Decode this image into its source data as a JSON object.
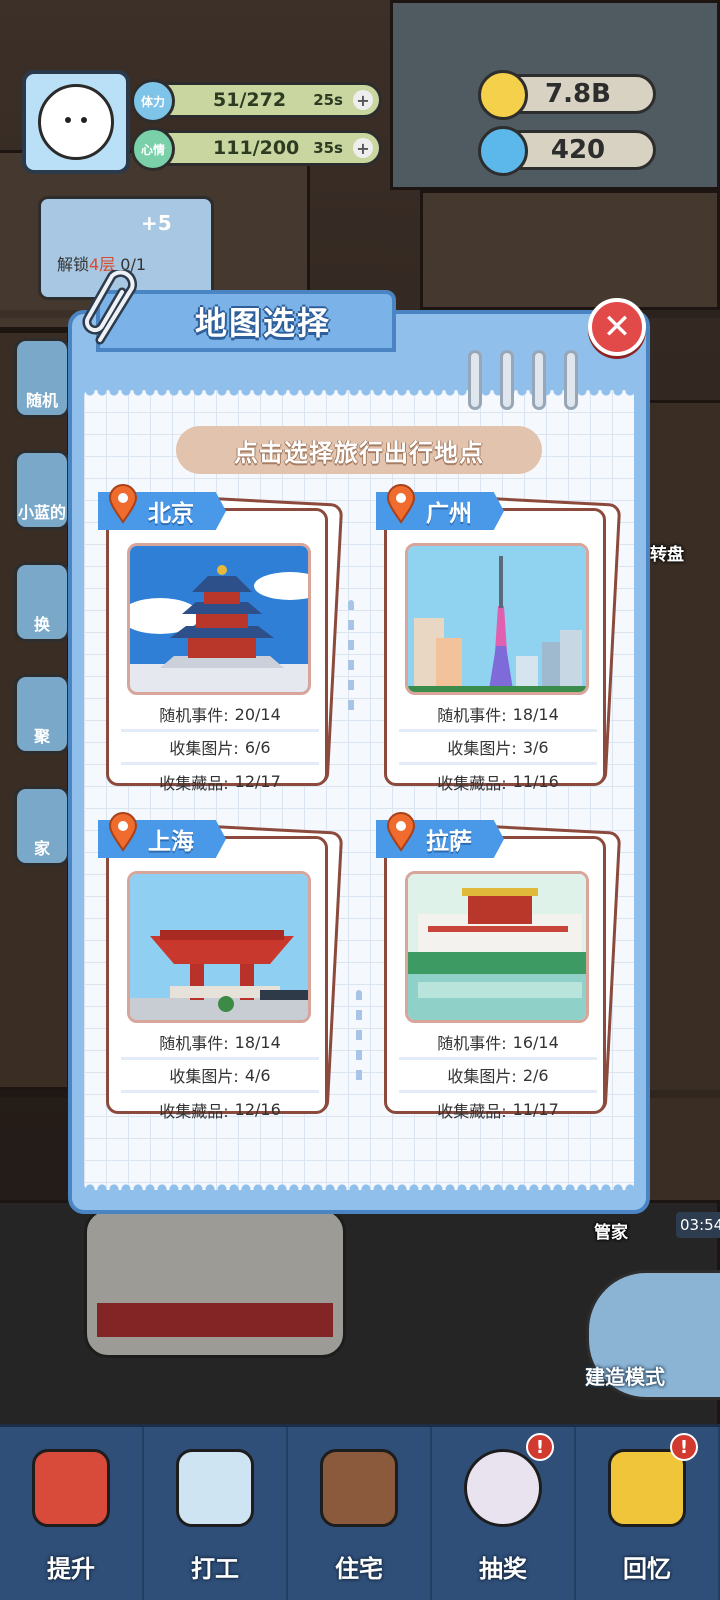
{
  "hud": {
    "stamina_label": "体力",
    "stamina_value": "51/272",
    "stamina_timer": "25s",
    "mood_label": "心情",
    "mood_value": "111/200",
    "mood_timer": "35s",
    "coins": "7.8B",
    "gems": "420",
    "unlock_prefix": "解锁",
    "unlock_highlight": "4层",
    "unlock_progress": "0/1",
    "unlock_badge": "+5"
  },
  "side_buttons": [
    "随机",
    "小蓝的",
    "换",
    "聚",
    "家"
  ],
  "right_labels": {
    "wheel": "转盘",
    "butler": "管家",
    "butler_timer": "03:54",
    "build_mode": "建造模式"
  },
  "modal": {
    "title": "地图选择",
    "subtitle": "点击选择旅行出行地点",
    "close_symbol": "✕",
    "cities": [
      {
        "name": "北京",
        "events_label": "随机事件:",
        "events": "20/14",
        "photos_label": "收集图片:",
        "photos": "6/6",
        "items_label": "收集藏品:",
        "items": "12/17"
      },
      {
        "name": "广州",
        "events_label": "随机事件:",
        "events": "18/14",
        "photos_label": "收集图片:",
        "photos": "3/6",
        "items_label": "收集藏品:",
        "items": "11/16"
      },
      {
        "name": "上海",
        "events_label": "随机事件:",
        "events": "18/14",
        "photos_label": "收集图片:",
        "photos": "4/6",
        "items_label": "收集藏品:",
        "items": "12/16"
      },
      {
        "name": "拉萨",
        "events_label": "随机事件:",
        "events": "16/14",
        "photos_label": "收集图片:",
        "photos": "2/6",
        "items_label": "收集藏品:",
        "items": "11/17"
      }
    ]
  },
  "bottom_nav": [
    {
      "label": "提升",
      "alert": ""
    },
    {
      "label": "打工",
      "alert": ""
    },
    {
      "label": "住宅",
      "alert": ""
    },
    {
      "label": "抽奖",
      "alert": "!"
    },
    {
      "label": "回忆",
      "alert": "!"
    }
  ],
  "colors": {
    "modal_frame": "#8fbfea",
    "modal_border": "#4a84c3",
    "card_border": "#8b4a3c",
    "city_tag": "#4a98e8",
    "banner": "#e2c3ad",
    "close_button": "#e24a4a",
    "nav_bg": "#2f4f79"
  }
}
